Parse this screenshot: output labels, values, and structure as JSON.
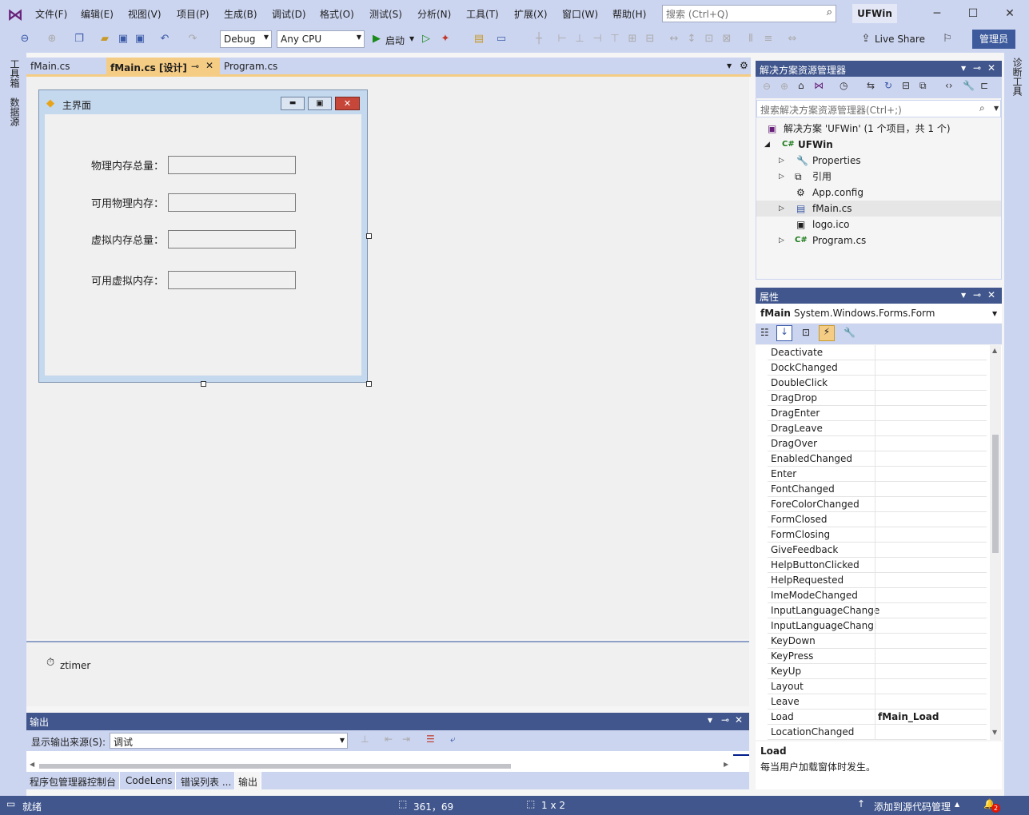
{
  "menu": [
    "文件(F)",
    "编辑(E)",
    "视图(V)",
    "项目(P)",
    "生成(B)",
    "调试(D)",
    "格式(O)",
    "测试(S)",
    "分析(N)",
    "工具(T)",
    "扩展(X)",
    "窗口(W)",
    "帮助(H)"
  ],
  "search": {
    "placeholder": "搜索 (Ctrl+Q)"
  },
  "solution_badge": "UFWin",
  "toolbar": {
    "config": "Debug",
    "platform": "Any CPU",
    "start_label": "启动",
    "live_share": "Live Share",
    "admin": "管理员"
  },
  "left_strip": {
    "toolbox": "工具箱",
    "datasource": "数据源"
  },
  "right_strip": {
    "diag": "诊断工具"
  },
  "doc_tabs": [
    {
      "label": "fMain.cs",
      "active": false
    },
    {
      "label": "fMain.cs [设计]",
      "active": true
    },
    {
      "label": "Program.cs",
      "active": false
    }
  ],
  "form": {
    "title": "主界面",
    "labels": [
      "物理内存总量：",
      "可用物理内存：",
      "虚拟内存总量：",
      "可用虚拟内存："
    ]
  },
  "tray": {
    "component": "ztimer"
  },
  "output": {
    "title": "输出",
    "source_label": "显示输出来源(S):",
    "source_value": "调试"
  },
  "bottom_tabs": [
    "程序包管理器控制台",
    "CodeLens",
    "错误列表 ...",
    "输出"
  ],
  "solution_explorer": {
    "title": "解决方案资源管理器",
    "search_placeholder": "搜索解决方案资源管理器(Ctrl+;)",
    "solution_line": "解决方案 'UFWin' (1 个项目，共 1 个)",
    "project": "UFWin",
    "items": [
      "Properties",
      "引用",
      "App.config",
      "fMain.cs",
      "logo.ico",
      "Program.cs"
    ]
  },
  "properties": {
    "title": "属性",
    "object_name": "fMain",
    "object_type": "System.Windows.Forms.Form",
    "rows": [
      {
        "name": "Deactivate",
        "value": ""
      },
      {
        "name": "DockChanged",
        "value": ""
      },
      {
        "name": "DoubleClick",
        "value": ""
      },
      {
        "name": "DragDrop",
        "value": ""
      },
      {
        "name": "DragEnter",
        "value": ""
      },
      {
        "name": "DragLeave",
        "value": ""
      },
      {
        "name": "DragOver",
        "value": ""
      },
      {
        "name": "EnabledChanged",
        "value": ""
      },
      {
        "name": "Enter",
        "value": ""
      },
      {
        "name": "FontChanged",
        "value": ""
      },
      {
        "name": "ForeColorChanged",
        "value": ""
      },
      {
        "name": "FormClosed",
        "value": ""
      },
      {
        "name": "FormClosing",
        "value": ""
      },
      {
        "name": "GiveFeedback",
        "value": ""
      },
      {
        "name": "HelpButtonClicked",
        "value": ""
      },
      {
        "name": "HelpRequested",
        "value": ""
      },
      {
        "name": "ImeModeChanged",
        "value": ""
      },
      {
        "name": "InputLanguageChange",
        "value": ""
      },
      {
        "name": "InputLanguageChangi",
        "value": ""
      },
      {
        "name": "KeyDown",
        "value": ""
      },
      {
        "name": "KeyPress",
        "value": ""
      },
      {
        "name": "KeyUp",
        "value": ""
      },
      {
        "name": "Layout",
        "value": ""
      },
      {
        "name": "Leave",
        "value": ""
      },
      {
        "name": "Load",
        "value": "fMain_Load"
      },
      {
        "name": "LocationChanged",
        "value": ""
      }
    ],
    "desc_title": "Load",
    "desc_text": "每当用户加载窗体时发生。"
  },
  "status": {
    "ready": "就绪",
    "position": "361，69",
    "size": "1 x 2",
    "source_control": "添加到源代码管理",
    "notif_count": "2"
  },
  "colors": {
    "accent": "#40568d",
    "chrome": "#ccd5f0",
    "active_tab": "#f5cc84"
  }
}
